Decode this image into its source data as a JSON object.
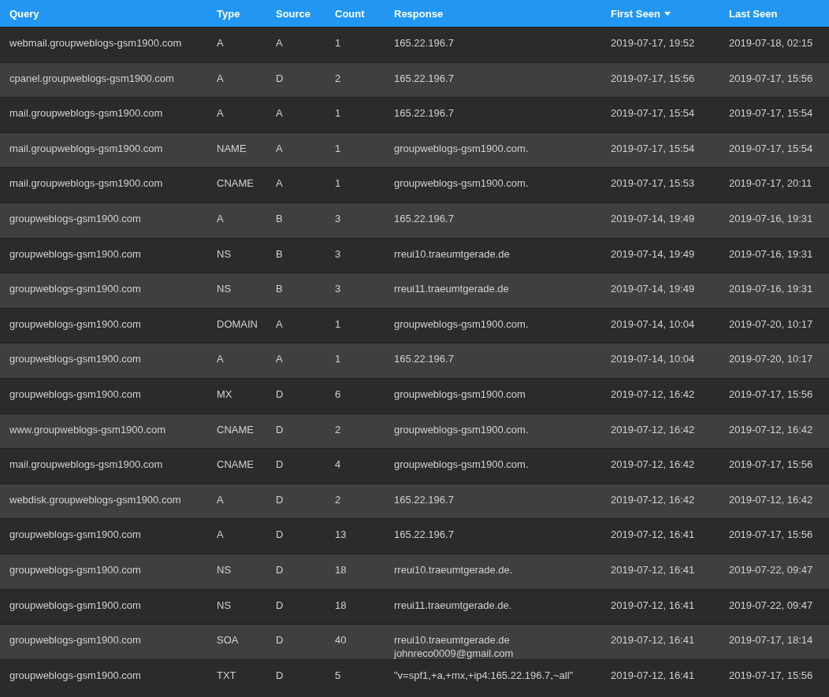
{
  "table": {
    "columns": [
      {
        "label": "Query",
        "sorted": false
      },
      {
        "label": "Type",
        "sorted": false
      },
      {
        "label": "Source",
        "sorted": false
      },
      {
        "label": "Count",
        "sorted": false
      },
      {
        "label": "Response",
        "sorted": false
      },
      {
        "label": "First Seen",
        "sorted": true
      },
      {
        "label": "Last Seen",
        "sorted": false
      }
    ],
    "rows": [
      {
        "query": "webmail.groupweblogs-gsm1900.com",
        "type": "A",
        "source": "A",
        "count": "1",
        "response": "165.22.196.7",
        "first_seen": "2019-07-17, 19:52",
        "last_seen": "2019-07-18, 02:15"
      },
      {
        "query": "cpanel.groupweblogs-gsm1900.com",
        "type": "A",
        "source": "D",
        "count": "2",
        "response": "165.22.196.7",
        "first_seen": "2019-07-17, 15:56",
        "last_seen": "2019-07-17, 15:56"
      },
      {
        "query": "mail.groupweblogs-gsm1900.com",
        "type": "A",
        "source": "A",
        "count": "1",
        "response": "165.22.196.7",
        "first_seen": "2019-07-17, 15:54",
        "last_seen": "2019-07-17, 15:54"
      },
      {
        "query": "mail.groupweblogs-gsm1900.com",
        "type": "NAME",
        "source": "A",
        "count": "1",
        "response": "groupweblogs-gsm1900.com.",
        "first_seen": "2019-07-17, 15:54",
        "last_seen": "2019-07-17, 15:54"
      },
      {
        "query": "mail.groupweblogs-gsm1900.com",
        "type": "CNAME",
        "source": "A",
        "count": "1",
        "response": "groupweblogs-gsm1900.com.",
        "first_seen": "2019-07-17, 15:53",
        "last_seen": "2019-07-17, 20:11"
      },
      {
        "query": "groupweblogs-gsm1900.com",
        "type": "A",
        "source": "B",
        "count": "3",
        "response": "165.22.196.7",
        "first_seen": "2019-07-14, 19:49",
        "last_seen": "2019-07-16, 19:31"
      },
      {
        "query": "groupweblogs-gsm1900.com",
        "type": "NS",
        "source": "B",
        "count": "3",
        "response": "rreui10.traeumtgerade.de",
        "first_seen": "2019-07-14, 19:49",
        "last_seen": "2019-07-16, 19:31"
      },
      {
        "query": "groupweblogs-gsm1900.com",
        "type": "NS",
        "source": "B",
        "count": "3",
        "response": "rreui11.traeumtgerade.de",
        "first_seen": "2019-07-14, 19:49",
        "last_seen": "2019-07-16, 19:31"
      },
      {
        "query": "groupweblogs-gsm1900.com",
        "type": "DOMAIN",
        "source": "A",
        "count": "1",
        "response": "groupweblogs-gsm1900.com.",
        "first_seen": "2019-07-14, 10:04",
        "last_seen": "2019-07-20, 10:17"
      },
      {
        "query": "groupweblogs-gsm1900.com",
        "type": "A",
        "source": "A",
        "count": "1",
        "response": "165.22.196.7",
        "first_seen": "2019-07-14, 10:04",
        "last_seen": "2019-07-20, 10:17"
      },
      {
        "query": "groupweblogs-gsm1900.com",
        "type": "MX",
        "source": "D",
        "count": "6",
        "response": "groupweblogs-gsm1900.com",
        "first_seen": "2019-07-12, 16:42",
        "last_seen": "2019-07-17, 15:56"
      },
      {
        "query": "www.groupweblogs-gsm1900.com",
        "type": "CNAME",
        "source": "D",
        "count": "2",
        "response": "groupweblogs-gsm1900.com.",
        "first_seen": "2019-07-12, 16:42",
        "last_seen": "2019-07-12, 16:42"
      },
      {
        "query": "mail.groupweblogs-gsm1900.com",
        "type": "CNAME",
        "source": "D",
        "count": "4",
        "response": "groupweblogs-gsm1900.com.",
        "first_seen": "2019-07-12, 16:42",
        "last_seen": "2019-07-17, 15:56"
      },
      {
        "query": "webdisk.groupweblogs-gsm1900.com",
        "type": "A",
        "source": "D",
        "count": "2",
        "response": "165.22.196.7",
        "first_seen": "2019-07-12, 16:42",
        "last_seen": "2019-07-12, 16:42"
      },
      {
        "query": "groupweblogs-gsm1900.com",
        "type": "A",
        "source": "D",
        "count": "13",
        "response": "165.22.196.7",
        "first_seen": "2019-07-12, 16:41",
        "last_seen": "2019-07-17, 15:56"
      },
      {
        "query": "groupweblogs-gsm1900.com",
        "type": "NS",
        "source": "D",
        "count": "18",
        "response": "rreui10.traeumtgerade.de.",
        "first_seen": "2019-07-12, 16:41",
        "last_seen": "2019-07-22, 09:47"
      },
      {
        "query": "groupweblogs-gsm1900.com",
        "type": "NS",
        "source": "D",
        "count": "18",
        "response": "rreui11.traeumtgerade.de.",
        "first_seen": "2019-07-12, 16:41",
        "last_seen": "2019-07-22, 09:47"
      },
      {
        "query": "groupweblogs-gsm1900.com",
        "type": "SOA",
        "source": "D",
        "count": "40",
        "response": "rreui10.traeumtgerade.de\njohnreco0009@gmail.com",
        "first_seen": "2019-07-12, 16:41",
        "last_seen": "2019-07-17, 18:14"
      },
      {
        "query": "groupweblogs-gsm1900.com",
        "type": "TXT",
        "source": "D",
        "count": "5",
        "response": "\"v=spf1,+a,+mx,+ip4:165.22.196.7,~all\"",
        "first_seen": "2019-07-12, 16:41",
        "last_seen": "2019-07-17, 15:56"
      }
    ]
  }
}
